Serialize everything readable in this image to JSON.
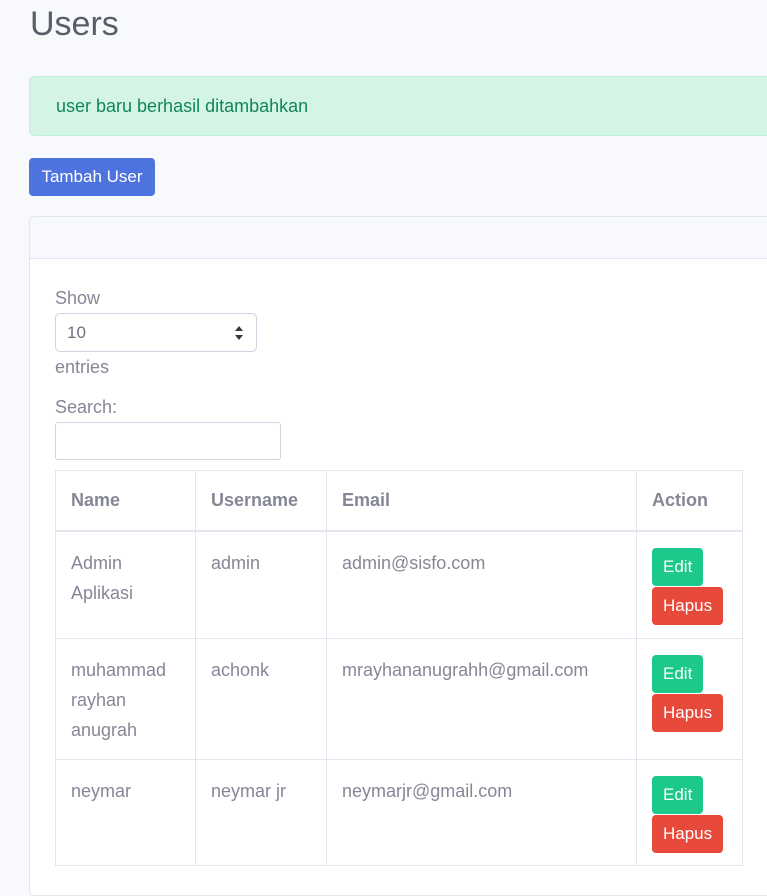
{
  "page": {
    "title": "Users"
  },
  "alert": {
    "message": "user baru berhasil ditambahkan"
  },
  "toolbar": {
    "add_user_label": "Tambah User"
  },
  "datatable": {
    "show_label": "Show",
    "entries_value": "10",
    "entries_label": "entries",
    "search_label": "Search:",
    "search_value": ""
  },
  "table": {
    "headers": {
      "name": "Name",
      "username": "Username",
      "email": "Email",
      "action": "Action"
    },
    "edit_label": "Edit",
    "delete_label": "Hapus",
    "rows": [
      {
        "name": "Admin Aplikasi",
        "username": "admin",
        "email": "admin@sisfo.com"
      },
      {
        "name": "muhammad rayhan anugrah",
        "username": "achonk",
        "email": "mrayhananugrahh@gmail.com"
      },
      {
        "name": "neymar",
        "username": "neymar jr",
        "email": "neymarjr@gmail.com"
      }
    ]
  },
  "colors": {
    "primary": "#4e73df",
    "success": "#1cc88a",
    "danger": "#e74a3b",
    "alert_bg": "#d4f4e5",
    "alert_text": "#13855c"
  }
}
